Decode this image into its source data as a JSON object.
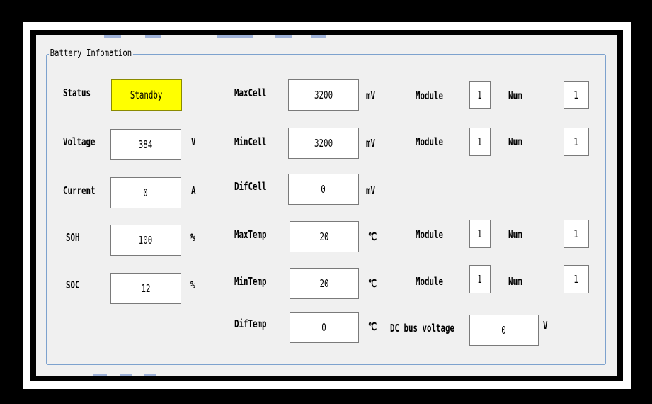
{
  "group_title": "Battery Infomation",
  "colors": {
    "status_bg": "#ffff00",
    "groupbox_border": "#7da2ce"
  },
  "left": {
    "status_label": "Status",
    "status_value": "Standby",
    "voltage_label": "Voltage",
    "voltage_value": "384",
    "voltage_unit": "V",
    "current_label": "Current",
    "current_value": "0",
    "current_unit": "A",
    "soh_label": "SOH",
    "soh_value": "100",
    "soh_unit": "%",
    "soc_label": "SOC",
    "soc_value": "12",
    "soc_unit": "%"
  },
  "middle": {
    "maxcell_label": "MaxCell",
    "maxcell_value": "3200",
    "maxcell_unit": "mV",
    "mincell_label": "MinCell",
    "mincell_value": "3200",
    "mincell_unit": "mV",
    "difcell_label": "DifCell",
    "difcell_value": "0",
    "difcell_unit": "mV",
    "maxtemp_label": "MaxTemp",
    "maxtemp_value": "20",
    "maxtemp_unit": "℃",
    "mintemp_label": "MinTemp",
    "mintemp_value": "20",
    "mintemp_unit": "℃",
    "diftemp_label": "DifTemp",
    "diftemp_value": "0",
    "diftemp_unit": "℃"
  },
  "right": {
    "maxcell_module_label": "Module",
    "maxcell_module_value": "1",
    "maxcell_num_label": "Num",
    "maxcell_num_value": "1",
    "mincell_module_label": "Module",
    "mincell_module_value": "1",
    "mincell_num_label": "Num",
    "mincell_num_value": "1",
    "maxtemp_module_label": "Module",
    "maxtemp_module_value": "1",
    "maxtemp_num_label": "Num",
    "maxtemp_num_value": "1",
    "mintemp_module_label": "Module",
    "mintemp_module_value": "1",
    "mintemp_num_label": "Num",
    "mintemp_num_value": "1",
    "dcbus_label": "DC bus voltage",
    "dcbus_value": "0",
    "dcbus_unit": "V"
  }
}
